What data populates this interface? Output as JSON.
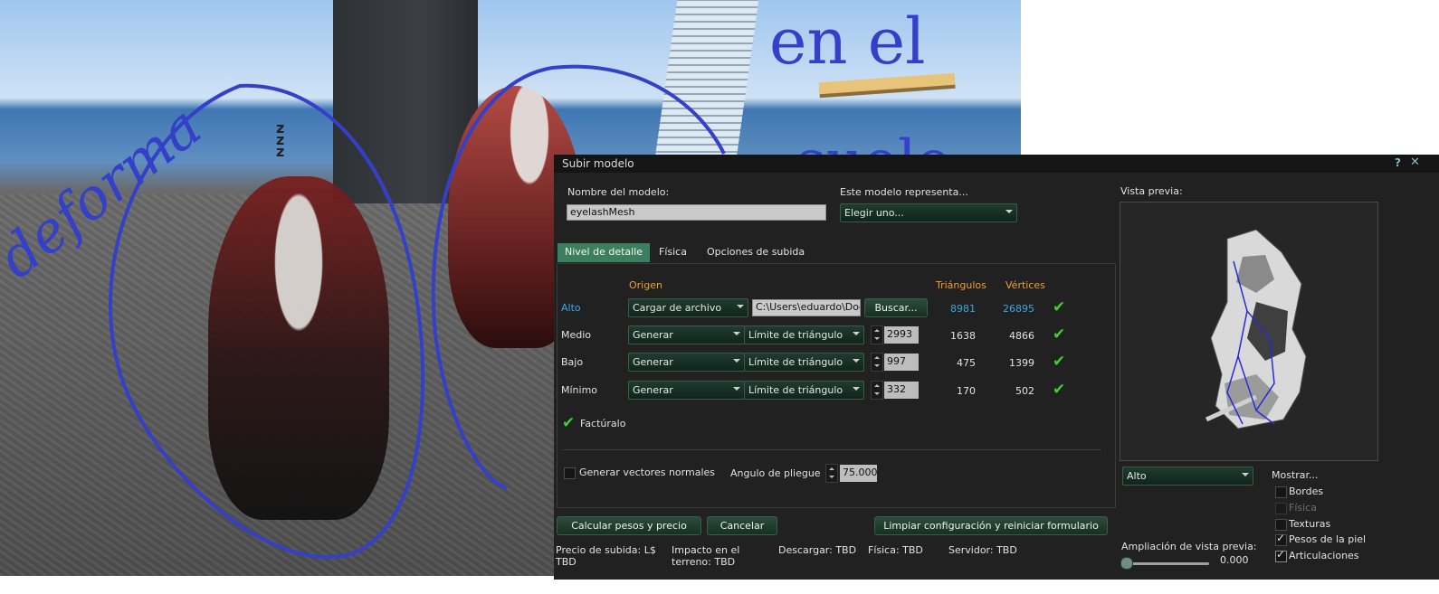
{
  "window": {
    "title": "Subir modelo"
  },
  "model_name": {
    "label": "Nombre del modelo:",
    "value": "eyelashMesh"
  },
  "represents": {
    "label": "Este modelo representa...",
    "value": "Elegir uno..."
  },
  "tabs": [
    {
      "label": "Nivel de detalle",
      "active": true
    },
    {
      "label": "Física",
      "active": false
    },
    {
      "label": "Opciones de subida",
      "active": false
    }
  ],
  "lod": {
    "header_source": "Origen",
    "header_triangles": "Triángulos",
    "header_vertices": "Vértices",
    "rows": [
      {
        "name": "Alto",
        "source": "Cargar de archivo",
        "file": "C:\\Users\\eduardo\\Doc",
        "browse": "Buscar...",
        "triangles": "8981",
        "vertices": "26895"
      },
      {
        "name": "Medio",
        "source": "Generar",
        "mode": "Límite de triángulo",
        "limit": "2993",
        "triangles": "1638",
        "vertices": "4866"
      },
      {
        "name": "Bajo",
        "source": "Generar",
        "mode": "Límite de triángulo",
        "limit": "997",
        "triangles": "475",
        "vertices": "1399"
      },
      {
        "name": "Mínimo",
        "source": "Generar",
        "mode": "Límite de triángulo",
        "limit": "332",
        "triangles": "170",
        "vertices": "502"
      }
    ],
    "factor_label": "Factúralo",
    "normals_label": "Generar vectores normales",
    "crease_label": "Angulo de pliegue",
    "crease_value": "75.000"
  },
  "buttons": {
    "calculate": "Calcular pesos y precio",
    "cancel": "Cancelar",
    "reset": "Limpiar configuración y reiniciar formulario"
  },
  "status": {
    "price": "Precio de subida: L$ TBD",
    "impact": "Impacto en el terreno: TBD",
    "download": "Descargar: TBD",
    "physics": "Física: TBD",
    "server": "Servidor: TBD"
  },
  "preview": {
    "label": "Vista previa:",
    "lod_value": "Alto",
    "show_label": "Mostrar...",
    "options": [
      {
        "label": "Bordes",
        "checked": false,
        "enabled": true
      },
      {
        "label": "Física",
        "checked": false,
        "enabled": false
      },
      {
        "label": "Texturas",
        "checked": false,
        "enabled": true
      },
      {
        "label": "Pesos de la piel",
        "checked": true,
        "enabled": true
      },
      {
        "label": "Articulaciones",
        "checked": true,
        "enabled": true
      }
    ],
    "zoom_label": "Ampliación de vista previa:",
    "zoom_value": "0.000",
    "zoom_level": 0
  },
  "scene": {
    "handwriting_1": "deforma",
    "handwriting_2": "en el",
    "handwriting_3": "suelo"
  },
  "colors": {
    "accent_green": "#3c7f5f",
    "header_orange": "#f0a032",
    "value_blue": "#3ba7e3",
    "check_green": "#3fcf2f",
    "annotation_blue": "#3440c8"
  }
}
